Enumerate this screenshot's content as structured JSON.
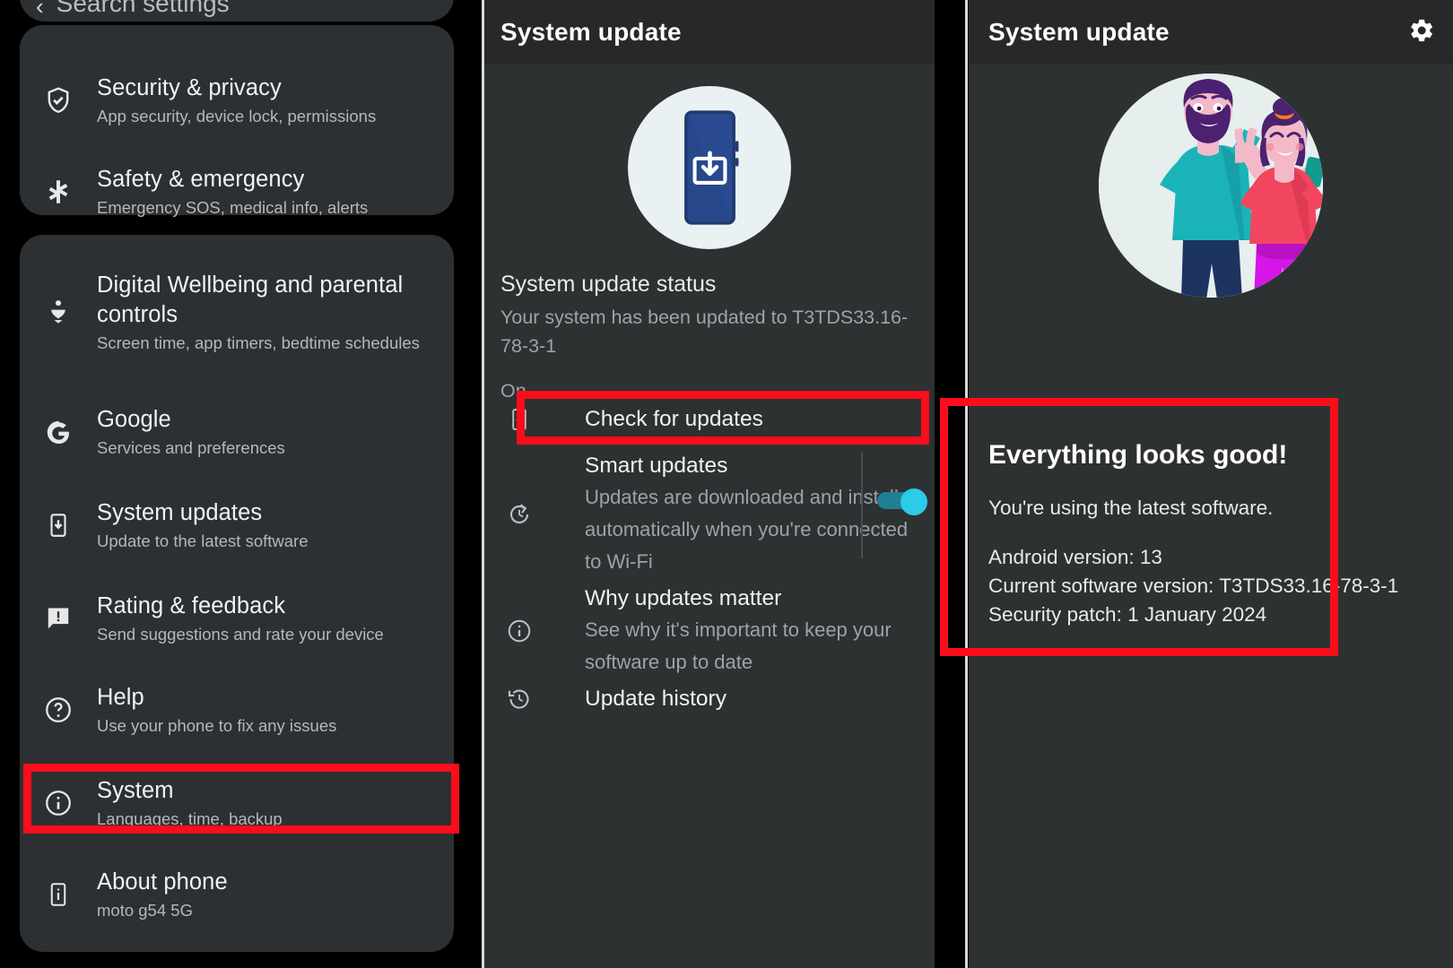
{
  "left_panel": {
    "search_bar": {
      "label": "Search settings",
      "back_icon": "back-chevron-icon"
    },
    "cards": [
      {
        "items": [
          {
            "icon": "shield-check-icon",
            "title": "Security & privacy",
            "subtitle": "App security, device lock, permissions"
          },
          {
            "icon": "asterisk-icon",
            "title": "Safety & emergency",
            "subtitle": "Emergency SOS, medical info, alerts"
          }
        ]
      },
      {
        "items": [
          {
            "icon": "wellbeing-icon",
            "title": "Digital Wellbeing and parental controls",
            "subtitle": "Screen time, app timers, bedtime schedules"
          },
          {
            "icon": "google-g-icon",
            "title": "Google",
            "subtitle": "Services and preferences"
          },
          {
            "icon": "system-update-icon",
            "title": "System updates",
            "subtitle": "Update to the latest software"
          },
          {
            "icon": "feedback-icon",
            "title": "Rating & feedback",
            "subtitle": "Send suggestions and rate your device"
          },
          {
            "icon": "help-circle-icon",
            "title": "Help",
            "subtitle": "Use your phone to fix any issues"
          },
          {
            "icon": "info-circle-icon",
            "title": "System",
            "subtitle": "Languages, time, backup"
          },
          {
            "icon": "phone-info-icon",
            "title": "About phone",
            "subtitle": "moto g54 5G"
          }
        ]
      }
    ]
  },
  "middle_panel": {
    "appbar": {
      "title": "System update"
    },
    "hero_icon": "phone-download-icon",
    "status": {
      "title": "System update status",
      "subtitle": "Your system has been updated to T3TDS33.16-78-3-1",
      "state": "On"
    },
    "items": [
      {
        "icon": "phone-check-icon",
        "title": "Check for updates",
        "subtitle": ""
      },
      {
        "icon": "refresh-update-icon",
        "title": "Smart updates",
        "subtitle": "Updates are downloaded and installed automatically when you're connected to Wi-Fi"
      },
      {
        "icon": "info-circle-icon",
        "title": "Why updates matter",
        "subtitle": "See why it's important to keep your software up to date"
      },
      {
        "icon": "history-icon",
        "title": "Update history",
        "subtitle": ""
      }
    ],
    "smart_updates_toggle": {
      "state": "on",
      "on_color": "#2ccbe8",
      "track_color": "#1f7f93"
    }
  },
  "right_panel": {
    "appbar": {
      "title": "System update",
      "gear_icon": "gear-icon"
    },
    "hero_illustration": "celebrating-people-illustration",
    "result": {
      "heading": "Everything looks good!",
      "message": "You're using the latest software.",
      "android_version": "Android version: 13",
      "software_version": "Current software version: T3TDS33.16-78-3-1",
      "security_patch": "Security patch: 1 January 2024"
    }
  },
  "annotations": {
    "highlight_color": "#fc0d1b",
    "boxes": [
      {
        "name": "system-row-highlight",
        "target": "System"
      },
      {
        "name": "check-for-updates-highlight",
        "target": "Check for updates"
      },
      {
        "name": "everything-looks-good-highlight",
        "target": "Everything looks good!"
      }
    ]
  }
}
